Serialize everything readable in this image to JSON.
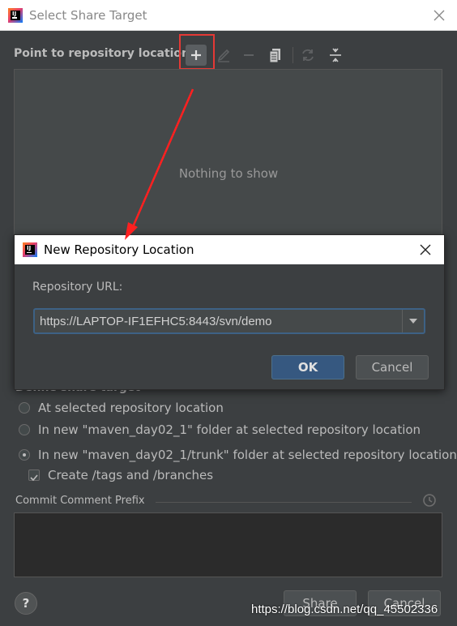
{
  "outer_dialog": {
    "title": "Select Share Target",
    "section_title": "Point to repository location",
    "empty_text": "Nothing to show",
    "define_title": "Define share target",
    "options": [
      "At selected repository location",
      "In new \"maven_day02_1\" folder at selected repository location",
      "In new \"maven_day02_1/trunk\" folder at selected repository location"
    ],
    "selected_option": 2,
    "checkbox_label": "Create /tags and /branches",
    "checkbox_checked": true,
    "comment_label": "Commit Comment Prefix",
    "help_label": "?",
    "share_label": "Share",
    "cancel_label": "Cancel"
  },
  "inner_dialog": {
    "title": "New Repository Location",
    "url_label": "Repository URL:",
    "url_value": "https://LAPTOP-IF1EFHC5:8443/svn/demo",
    "ok_label": "OK",
    "cancel_label": "Cancel"
  },
  "toolbar_icons": [
    "add-icon",
    "edit-icon",
    "remove-icon",
    "copy-icon",
    "refresh-icon",
    "collapse-icon"
  ],
  "watermark": "https://blog.csdn.net/qq_45502336",
  "colors": {
    "background": "#3c3f41",
    "accent_button": "#365880",
    "annotation": "#e53935",
    "focus_border": "#3d6185"
  }
}
